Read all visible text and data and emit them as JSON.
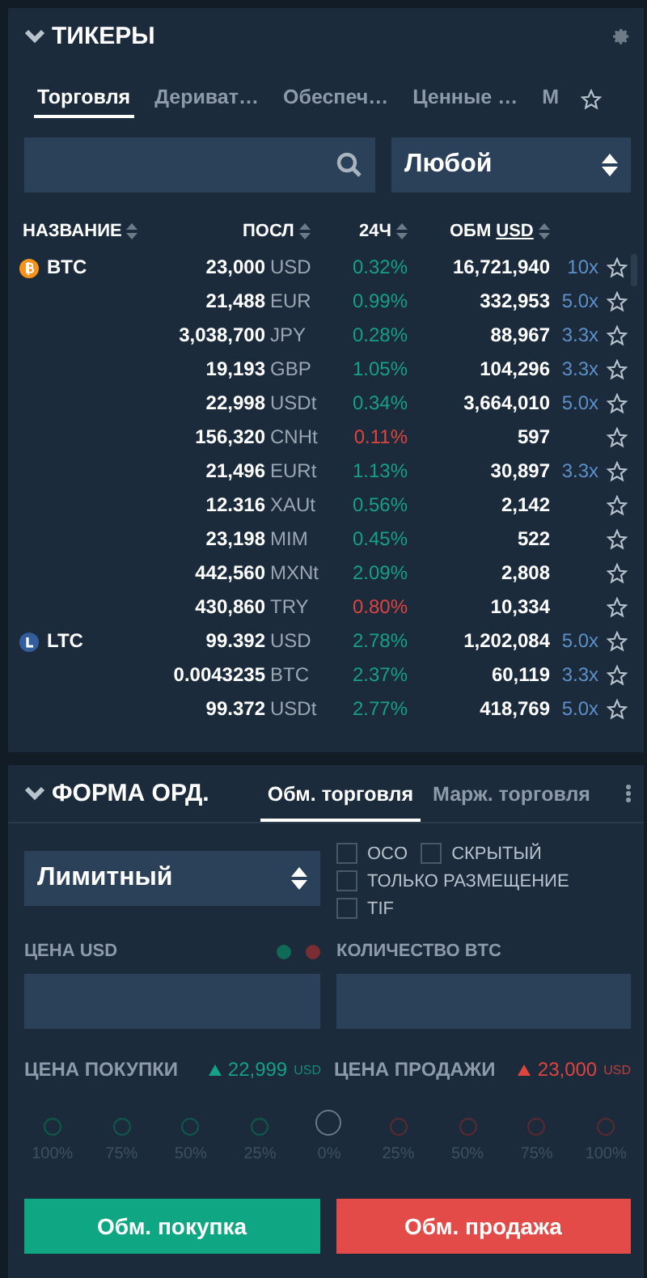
{
  "tickers": {
    "title": "ТИКЕРЫ",
    "tabs": [
      {
        "label": "Торговля",
        "selected": true
      },
      {
        "label": "Дериват…",
        "selected": false
      },
      {
        "label": "Обеспеч…",
        "selected": false
      },
      {
        "label": "Ценные …",
        "selected": false
      },
      {
        "label": "М",
        "selected": false
      }
    ],
    "filter": {
      "value": "Любой"
    },
    "columns": [
      {
        "label": "НАЗВАНИЕ"
      },
      {
        "label": "ПОСЛ"
      },
      {
        "label": "24Ч"
      },
      {
        "label": "ОБМ",
        "unit": "USD"
      }
    ],
    "rows": [
      {
        "symbol": "BTC",
        "kind": "bitcoin",
        "price": "23,000",
        "currency": "USD",
        "change": "0.32%",
        "falling": false,
        "volume": "16,721,940",
        "leverage": "10x"
      },
      {
        "price": "21,488",
        "currency": "EUR",
        "change": "0.99%",
        "falling": false,
        "volume": "332,953",
        "leverage": "5.0x"
      },
      {
        "price": "3,038,700",
        "currency": "JPY",
        "change": "0.28%",
        "falling": false,
        "volume": "88,967",
        "leverage": "3.3x"
      },
      {
        "price": "19,193",
        "currency": "GBP",
        "change": "1.05%",
        "falling": false,
        "volume": "104,296",
        "leverage": "3.3x"
      },
      {
        "price": "22,998",
        "currency": "USDt",
        "change": "0.34%",
        "falling": false,
        "volume": "3,664,010",
        "leverage": "5.0x"
      },
      {
        "price": "156,320",
        "currency": "CNHt",
        "change": "0.11%",
        "falling": true,
        "volume": "597"
      },
      {
        "price": "21,496",
        "currency": "EURt",
        "change": "1.13%",
        "falling": false,
        "volume": "30,897",
        "leverage": "3.3x"
      },
      {
        "price": "12.316",
        "currency": "XAUt",
        "change": "0.56%",
        "falling": false,
        "volume": "2,142"
      },
      {
        "price": "23,198",
        "currency": "MIM",
        "change": "0.45%",
        "falling": false,
        "volume": "522"
      },
      {
        "price": "442,560",
        "currency": "MXNt",
        "change": "2.09%",
        "falling": false,
        "volume": "2,808"
      },
      {
        "price": "430,860",
        "currency": "TRY",
        "change": "0.80%",
        "falling": true,
        "volume": "10,334"
      },
      {
        "symbol": "LTC",
        "kind": "litecoin",
        "price": "99.392",
        "currency": "USD",
        "change": "2.78%",
        "falling": false,
        "volume": "1,202,084",
        "leverage": "5.0x"
      },
      {
        "price": "0.0043235",
        "currency": "BTC",
        "change": "2.37%",
        "falling": false,
        "volume": "60,119",
        "leverage": "3.3x"
      },
      {
        "price": "99.372",
        "currency": "USDt",
        "change": "2.77%",
        "falling": false,
        "volume": "418,769",
        "leverage": "5.0x"
      }
    ]
  },
  "order_form": {
    "title": "ФОРМА ОРД.",
    "tabs": [
      {
        "label": "Обм. торговля",
        "selected": true
      },
      {
        "label": "Марж. торговля",
        "selected": false
      }
    ],
    "order_type": {
      "value": "Лимитный"
    },
    "options": [
      {
        "label": "OCO",
        "checked": false
      },
      {
        "label": "СКРЫТЫЙ",
        "checked": false
      },
      {
        "label": "ТОЛЬКО РАЗМЕЩЕНИЕ",
        "checked": false
      },
      {
        "label": "TIF",
        "checked": false
      }
    ],
    "price_label": "ЦЕНА USD",
    "price_dots": [
      {
        "color": "#0f6b55"
      },
      {
        "color": "#7a2e33"
      }
    ],
    "amount_label": "КОЛИЧЕСТВО BTC",
    "bid": {
      "label": "ЦЕНА ПОКУПКИ",
      "value": "22,999",
      "unit": "USD"
    },
    "ask": {
      "label": "ЦЕНА ПРОДАЖИ",
      "value": "23,000",
      "unit": "USD"
    },
    "percent_steps": [
      {
        "label": "100%",
        "color": "#10584a",
        "selected": false
      },
      {
        "label": "75%",
        "color": "#10584a",
        "selected": false
      },
      {
        "label": "50%",
        "color": "#10584a",
        "selected": false
      },
      {
        "label": "25%",
        "color": "#10584a",
        "selected": false
      },
      {
        "label": "0%",
        "color": "#6a7784",
        "selected": true
      },
      {
        "label": "25%",
        "color": "#5a2a30",
        "selected": false
      },
      {
        "label": "50%",
        "color": "#5a2a30",
        "selected": false
      },
      {
        "label": "75%",
        "color": "#5a2a30",
        "selected": false
      },
      {
        "label": "100%",
        "color": "#5a2a30",
        "selected": false
      }
    ],
    "buttons": [
      {
        "label": "Обм. покупка",
        "kind": "buy"
      },
      {
        "label": "Обм. продажа",
        "kind": "sell"
      }
    ]
  }
}
